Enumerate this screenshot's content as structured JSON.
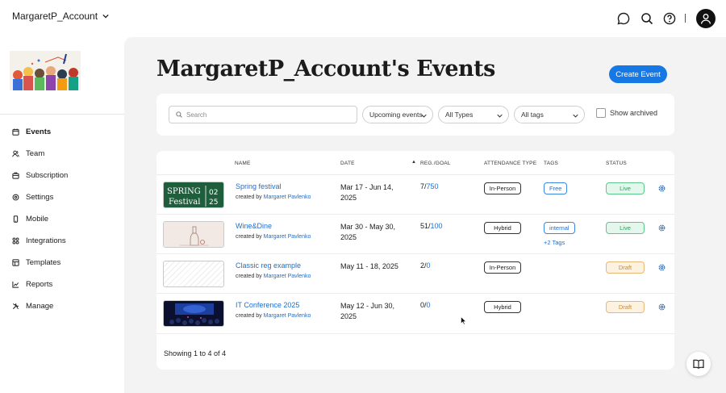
{
  "header": {
    "account_name": "MargaretP_Account",
    "icons": [
      "chat-icon",
      "search-icon",
      "help-icon",
      "user-icon"
    ]
  },
  "sidebar": {
    "items": [
      {
        "label": "Events",
        "icon": "calendar-icon",
        "active": true
      },
      {
        "label": "Team",
        "icon": "team-icon",
        "active": false
      },
      {
        "label": "Subscription",
        "icon": "subscription-icon",
        "active": false
      },
      {
        "label": "Settings",
        "icon": "settings-icon",
        "active": false
      },
      {
        "label": "Mobile",
        "icon": "mobile-icon",
        "active": false
      },
      {
        "label": "Integrations",
        "icon": "integrations-icon",
        "active": false
      },
      {
        "label": "Templates",
        "icon": "templates-icon",
        "active": false
      },
      {
        "label": "Reports",
        "icon": "reports-icon",
        "active": false
      },
      {
        "label": "Manage",
        "icon": "manage-icon",
        "active": false
      }
    ]
  },
  "main": {
    "title": "MargaretP_Account's Events",
    "create_button": "Create Event",
    "filters": {
      "search_placeholder": "Search",
      "time_filter": "Upcoming events",
      "type_filter": "All Types",
      "tag_filter": "All tags",
      "show_archived": "Show archived"
    },
    "table": {
      "columns": {
        "name": "NAME",
        "date": "DATE",
        "reg_goal": "REG./GOAL",
        "attendance": "ATTENDANCE TYPE",
        "tags": "TAGS",
        "status": "STATUS"
      },
      "rows": [
        {
          "name": "Spring festival",
          "created_prefix": "created by",
          "creator": "Margaret Pavlenko",
          "date": "Mar 17 - Jun 14, 2025",
          "reg": "7/",
          "goal": "750",
          "attendance": "In-Person",
          "tag": "Free",
          "more_tags": "",
          "status": "Live",
          "thumb": "spring-festival"
        },
        {
          "name": "Wine&Dine",
          "created_prefix": "created by",
          "creator": "Margaret Pavlenko",
          "date": "Mar 30 - May 30, 2025",
          "reg": "51/",
          "goal": "100",
          "attendance": "Hybrid",
          "tag": "internal",
          "more_tags": "+2 Tags",
          "status": "Live",
          "thumb": "wine"
        },
        {
          "name": "Classic reg example",
          "created_prefix": "created by",
          "creator": "Margaret Pavlenko",
          "date": "May 11 - 18, 2025",
          "reg": "2/",
          "goal": "0",
          "attendance": "In-Person",
          "tag": "",
          "more_tags": "",
          "status": "Draft",
          "thumb": "placeholder"
        },
        {
          "name": "IT Conference 2025",
          "created_prefix": "created by",
          "creator": "Margaret Pavlenko",
          "date": "May 12 - Jun 30, 2025",
          "reg": "0/",
          "goal": "0",
          "attendance": "Hybrid",
          "tag": "",
          "more_tags": "",
          "status": "Draft",
          "thumb": "conference"
        }
      ],
      "footer": "Showing 1 to 4 of 4"
    }
  },
  "thumbnails": {
    "spring_line1": "SPRING",
    "spring_line2": "Festival",
    "spring_year1": "02",
    "spring_year2": "25"
  },
  "colors": {
    "accent": "#1678e4",
    "live": "#27a35d",
    "draft": "#c98a2c",
    "spring_bg": "#1f5e3d"
  }
}
